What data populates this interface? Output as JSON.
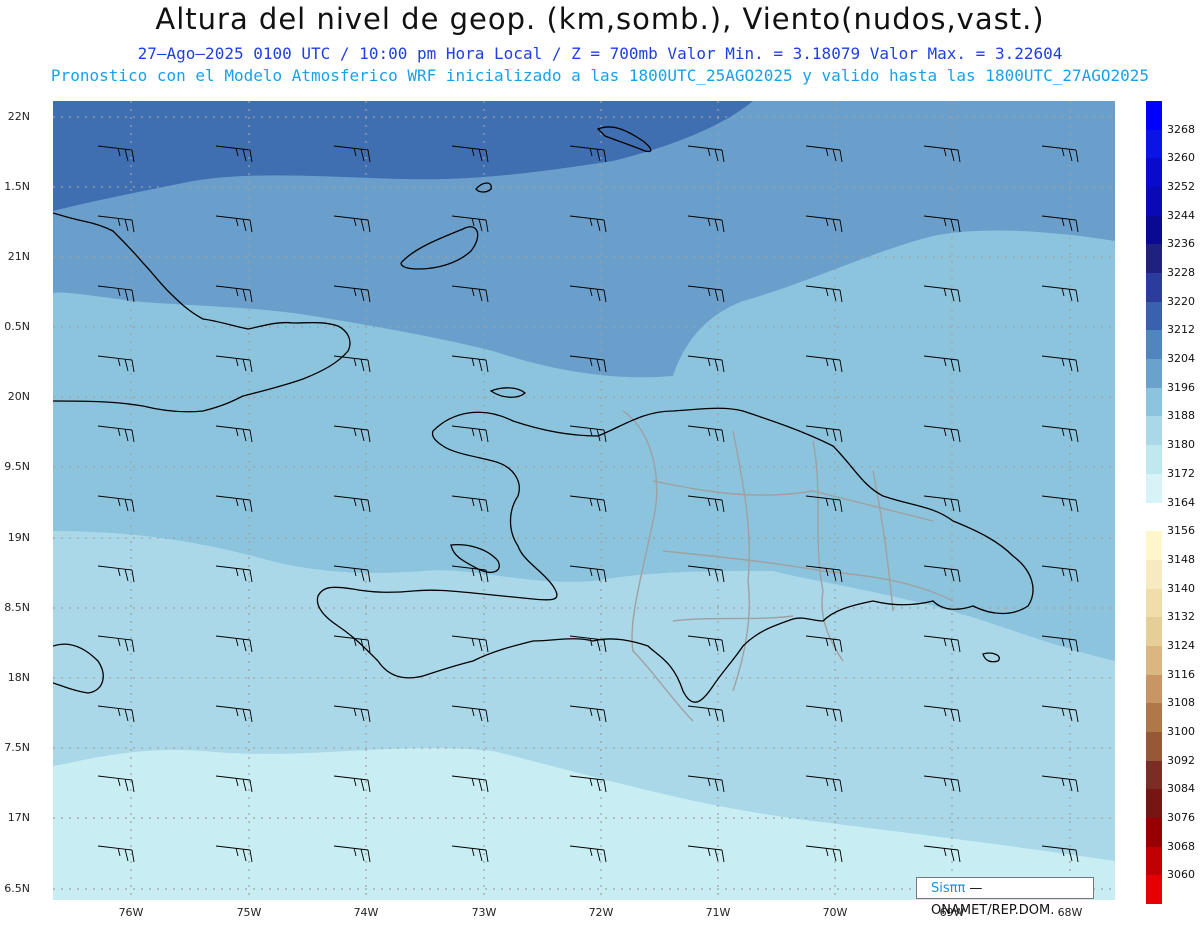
{
  "header": {
    "title": "Altura del nivel de geop. (km,somb.), Viento(nudos,vast.)",
    "subtitle_line1": "27—Ago—2025  0100 UTC / 10:00 pm Hora Local / Z = 700mb    Valor Min. = 3.18079  Valor Max. = 3.22604",
    "subtitle_line2": "Pronostico con el Modelo Atmosferico WRF inicializado a las 1800UTC_25AGO2025 y valido hasta las  1800UTC_27AGO2025"
  },
  "axes": {
    "lat_labels": [
      "22N",
      "1.5N",
      "21N",
      "0.5N",
      "20N",
      "9.5N",
      "19N",
      "8.5N",
      "18N",
      "7.5N",
      "17N",
      "6.5N"
    ],
    "lon_labels": [
      "76W",
      "75W",
      "74W",
      "73W",
      "72W",
      "71W",
      "70W",
      "69W",
      "68W"
    ]
  },
  "colorbar": {
    "levels": [
      "3268",
      "3260",
      "3252",
      "3244",
      "3236",
      "3228",
      "3220",
      "3212",
      "3204",
      "3196",
      "3188",
      "3180",
      "3172",
      "3164",
      "3156",
      "3148",
      "3140",
      "3132",
      "3124",
      "3116",
      "3108",
      "3100",
      "3092",
      "3084",
      "3076",
      "3068",
      "3060"
    ],
    "colors": [
      "#0000ff",
      "#0a14e6",
      "#0a0acd",
      "#0a0ab4",
      "#0a0a91",
      "#202080",
      "#2c3c9c",
      "#3a60b0",
      "#4f86c0",
      "#6aa2cc",
      "#8cc4de",
      "#aad8e8",
      "#c0e8ef",
      "#d8f3f7",
      "#ffffff",
      "#fff6cc",
      "#f7eac0",
      "#f0deaa",
      "#e6ce98",
      "#dab680",
      "#c89664",
      "#b07848",
      "#985838",
      "#7c2c24",
      "#781414",
      "#960000",
      "#c00000",
      "#e60000"
    ],
    "top_color": "#0000ff",
    "bottom_color": "#ff0000"
  },
  "map_colors": {
    "band_deep": "#3f6fb1",
    "band_mid": "#6a9fcc",
    "band_light": "#8cc4de",
    "band_pale": "#aad8e8",
    "band_palest": "#c8eef3",
    "coast": "#000000",
    "borders": "#a0a0a0",
    "grid": "#a0a0a0",
    "barbs": "#000000"
  },
  "credit": {
    "brand": "Sisππ",
    "text": " — ONAMET/REP.DOM."
  }
}
